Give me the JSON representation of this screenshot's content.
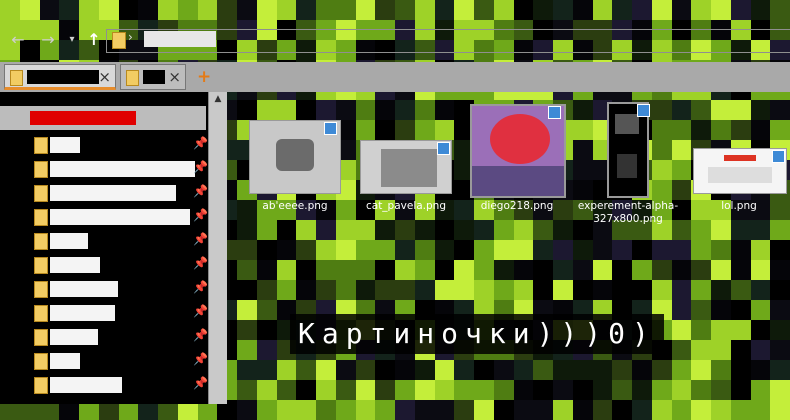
{
  "address_bar": {
    "back_icon": "back-arrow-icon",
    "forward_icon": "forward-arrow-icon",
    "recent_icon": "chevron-down-icon",
    "up_icon": "up-arrow-icon",
    "folder_icon": "folder-icon"
  },
  "tabs": [
    {
      "close_label": "×",
      "active": true
    },
    {
      "close_label": "×",
      "active": false
    }
  ],
  "new_tab_label": "+",
  "sidebar": {
    "items_count_visible": 12
  },
  "files": [
    {
      "name": "ab'eeee.png"
    },
    {
      "name": "cat_pavela.png"
    },
    {
      "name": "diego218.png"
    },
    {
      "name": "experement-alpha-327x800.png"
    },
    {
      "name": "lol.png"
    }
  ],
  "caption": "Картиночки)))0)",
  "colors": {
    "accent_tab": "#e78d2c",
    "cloud_badge": "#3e8ad6",
    "censor_red": "#e00000"
  }
}
